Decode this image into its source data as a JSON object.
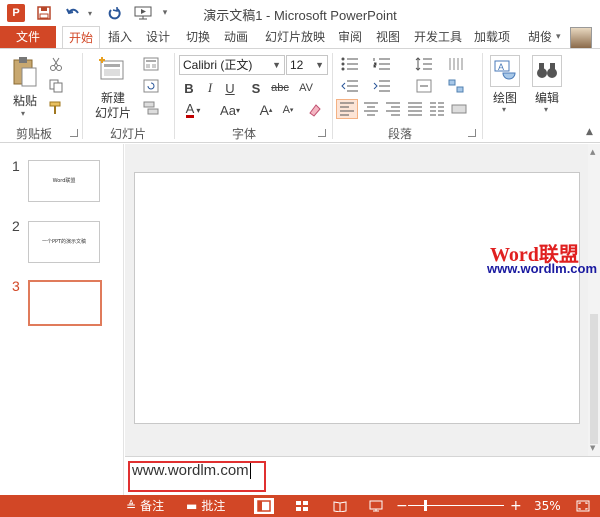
{
  "window": {
    "title": "演示文稿1 - Microsoft PowerPoint",
    "app_icon": "P"
  },
  "qat": {
    "save_icon": "save-icon",
    "undo_icon": "undo-icon",
    "redo_icon": "redo-icon",
    "present_icon": "present-icon"
  },
  "tabs": [
    {
      "label": "文件"
    },
    {
      "label": "开始"
    },
    {
      "label": "插入"
    },
    {
      "label": "设计"
    },
    {
      "label": "切换"
    },
    {
      "label": "动画"
    },
    {
      "label": "幻灯片放映"
    },
    {
      "label": "审阅"
    },
    {
      "label": "视图"
    },
    {
      "label": "开发工具"
    },
    {
      "label": "加载项"
    }
  ],
  "user": {
    "name": "胡俊"
  },
  "ribbon": {
    "clipboard": {
      "paste": "粘贴",
      "group": "剪贴板"
    },
    "slides": {
      "new_slide_line1": "新建",
      "new_slide_line2": "幻灯片",
      "group": "幻灯片"
    },
    "font": {
      "name": "Calibri (正文)",
      "size": "12",
      "group": "字体"
    },
    "paragraph": {
      "group": "段落"
    },
    "drawing": {
      "label": "绘图"
    },
    "editing": {
      "label": "编辑"
    }
  },
  "thumbnails": [
    {
      "number": "1",
      "text": "Word联盟"
    },
    {
      "number": "2",
      "text": "一个PPT的演示文稿"
    },
    {
      "number": "3",
      "text": ""
    }
  ],
  "watermark": {
    "logo": "Word联盟",
    "url": "www.wordlm.com"
  },
  "notes": {
    "text": "www.wordlm.com"
  },
  "status": {
    "notes_label": "备注",
    "comments_label": "批注",
    "zoom": "35%"
  },
  "colors": {
    "accent": "#d24726",
    "highlight": "#e03030"
  }
}
